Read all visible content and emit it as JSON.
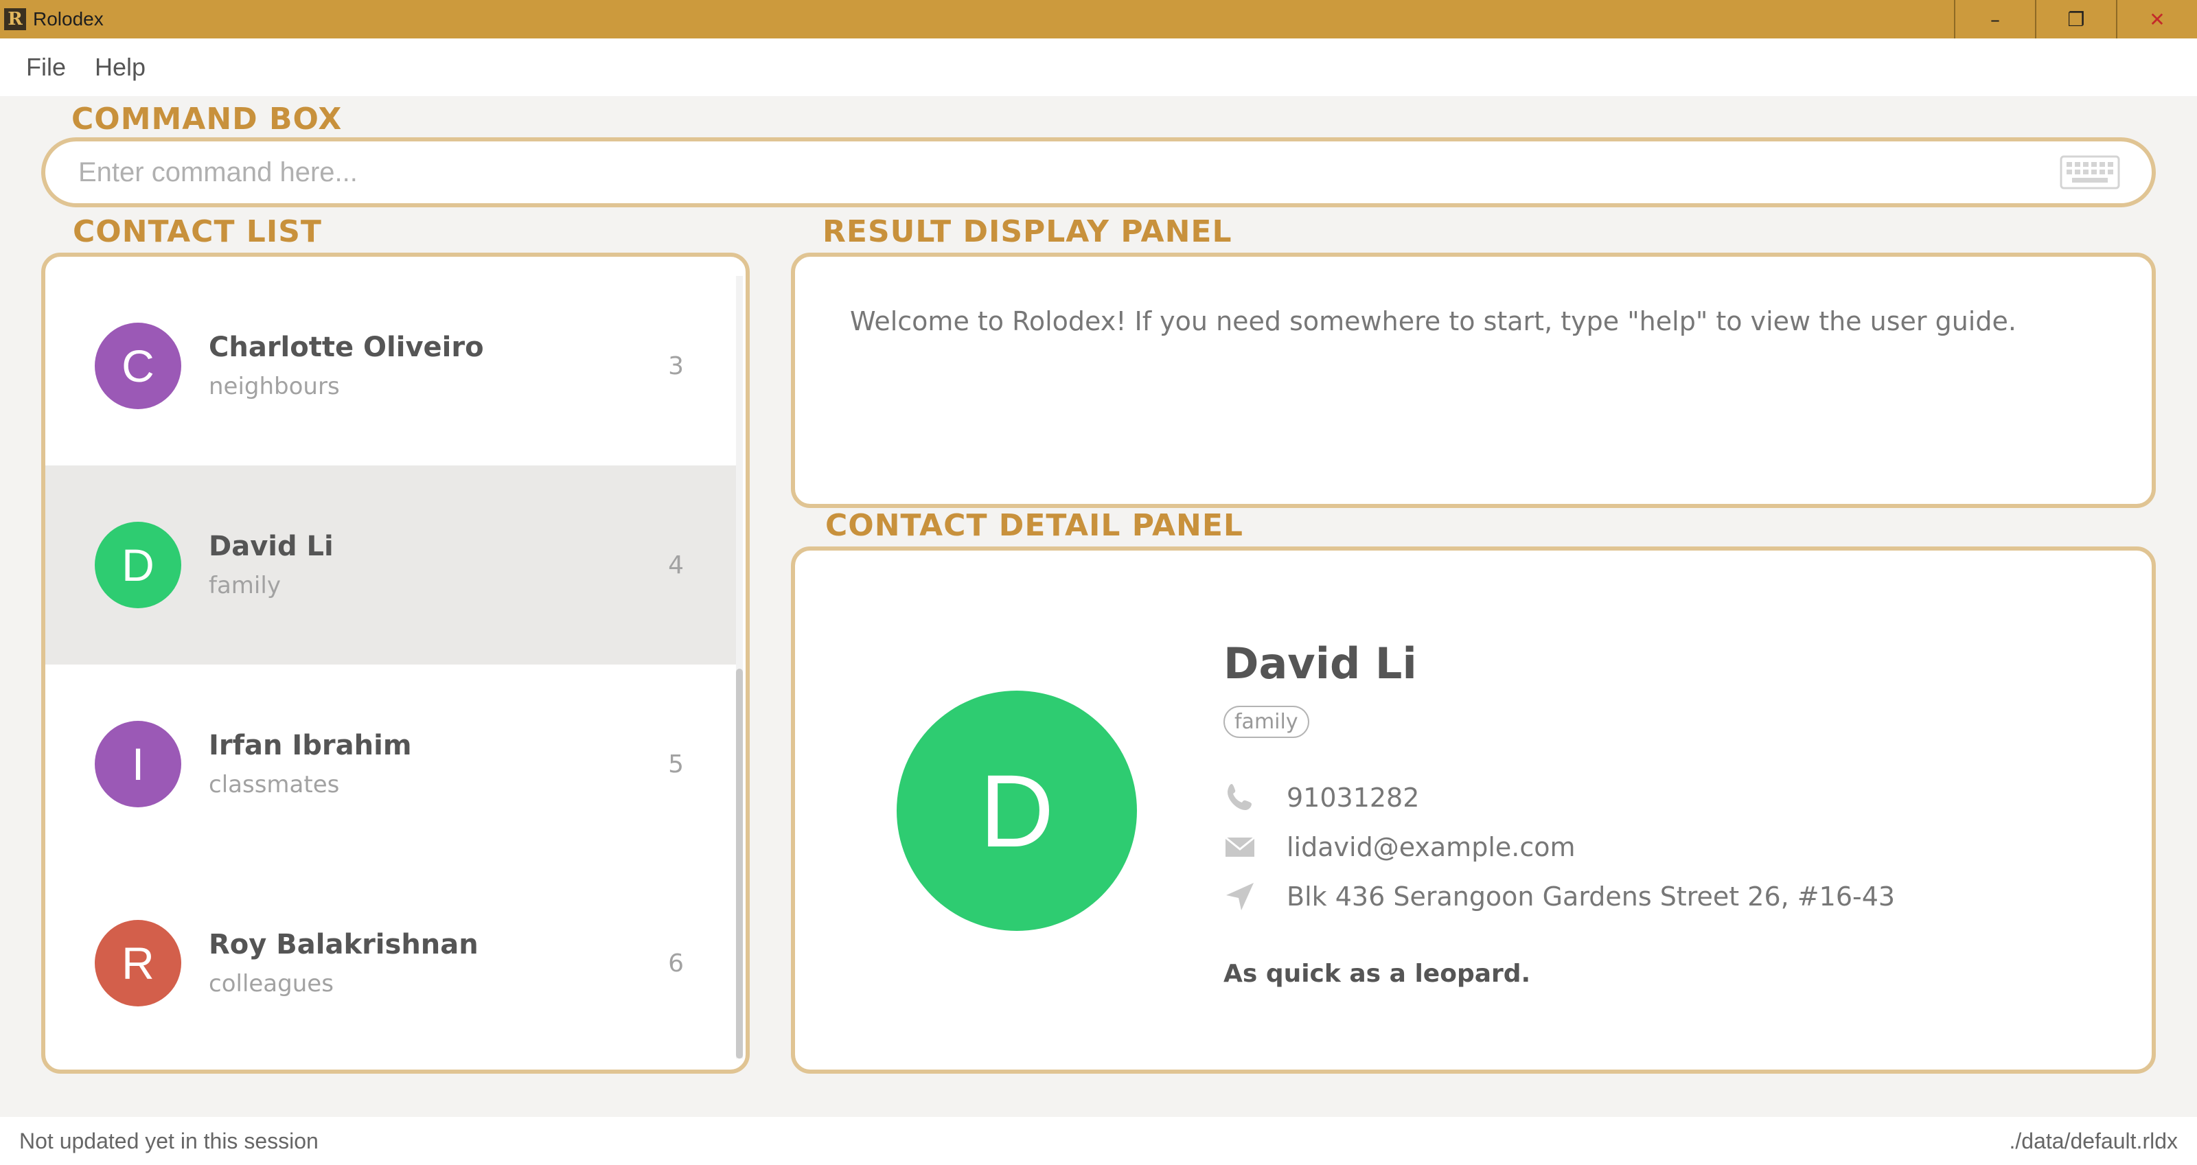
{
  "window": {
    "title": "Rolodex",
    "icon_letter": "R",
    "minimize_glyph": "–",
    "maximize_glyph": "❐",
    "close_glyph": "✕"
  },
  "menu": {
    "items": [
      {
        "label": "File"
      },
      {
        "label": "Help"
      }
    ]
  },
  "sections": {
    "command_box": "COMMAND BOX",
    "contact_list": "CONTACT LIST",
    "result_display": "RESULT DISPLAY PANEL",
    "contact_detail": "CONTACT DETAIL PANEL"
  },
  "command": {
    "placeholder": "Enter command here...",
    "value": "",
    "icon": "keyboard-icon"
  },
  "contacts": [
    {
      "initial": "C",
      "name": "Charlotte Oliveiro",
      "tag": "neighbours",
      "index": "3",
      "color": "#9b59b6",
      "selected": false
    },
    {
      "initial": "D",
      "name": "David Li",
      "tag": "family",
      "index": "4",
      "color": "#2ecc71",
      "selected": true
    },
    {
      "initial": "I",
      "name": "Irfan Ibrahim",
      "tag": "classmates",
      "index": "5",
      "color": "#9b59b6",
      "selected": false
    },
    {
      "initial": "R",
      "name": "Roy Balakrishnan",
      "tag": "colleagues",
      "index": "6",
      "color": "#d35f4b",
      "selected": false
    }
  ],
  "result": {
    "text": "Welcome to Rolodex! If you need somewhere to start, type \"help\" to view the user guide."
  },
  "detail": {
    "initial": "D",
    "color": "#2ecc71",
    "name": "David Li",
    "tag": "family",
    "phone": "91031282",
    "email": "lidavid@example.com",
    "address": "Blk 436 Serangoon Gardens Street 26, #16-43",
    "note": "As quick as a leopard.",
    "icons": [
      "phone-icon",
      "mail-icon",
      "location-arrow-icon"
    ]
  },
  "status": {
    "left": "Not updated yet in this session",
    "right": "./data/default.rldx"
  },
  "theme": {
    "titlebar": "#cc9a3d",
    "accent": "#c8913c",
    "panel_border": "#e0c493"
  }
}
